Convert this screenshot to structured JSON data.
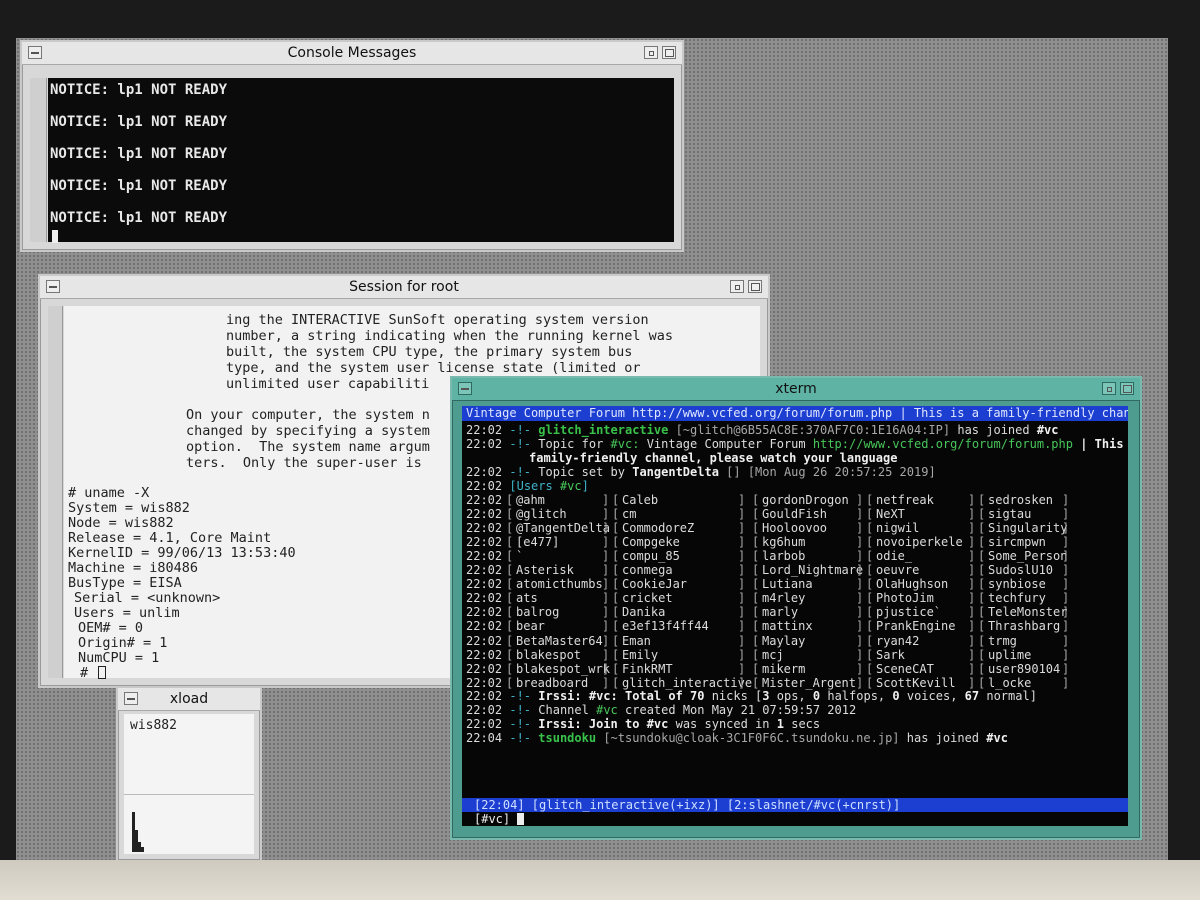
{
  "console": {
    "title": "Console Messages",
    "lines": [
      "NOTICE: lp1 NOT READY",
      "NOTICE: lp1 NOT READY",
      "NOTICE: lp1 NOT READY",
      "NOTICE: lp1 NOT READY",
      "NOTICE: lp1 NOT READY"
    ]
  },
  "session": {
    "title": "Session for root",
    "man_lines": [
      "ing the INTERACTIVE SunSoft operating system version",
      "number, a string indicating when the running kernel was",
      "built, the system CPU type, the primary system bus",
      "type, and the system user license state (limited or",
      "unlimited user capabiliti"
    ],
    "man_lines2": [
      "On your computer, the system n",
      "changed by specifying a system",
      "option.  The system name argum",
      "ters.  Only the super-user is"
    ],
    "cmd_lines": [
      "# uname -X",
      "System = wis882",
      "Node = wis882",
      "Release = 4.1, Core Maint",
      "KernelID = 99/06/13 13:53:40",
      "Machine = i80486",
      "BusType = EISA",
      "Serial = <unknown>",
      "Users = unlim",
      "OEM# = 0",
      "Origin# = 1",
      "NumCPU = 1",
      "# "
    ]
  },
  "xterm": {
    "title": "xterm",
    "topic_bar": "Vintage Computer Forum http://www.vcfed.org/forum/forum.php | This is a family-friendly channel, pl",
    "time": "22:02",
    "time_last": "22:04",
    "sep": "-!-",
    "join1": {
      "nick": "glitch_interactive",
      "host": "[~glitch@6B55AC8E:370AF7C0:1E16A04:IP]",
      "text": "has joined",
      "chan": "#vc"
    },
    "topic_line": {
      "prefix": "Topic for",
      "chan": "#vc:",
      "text": "Vintage Computer Forum",
      "url": "http://www.vcfed.org/forum/forum.php",
      "tail": "| This is a",
      "cont": "family-friendly channel, please watch your language"
    },
    "topic_set": {
      "prefix": "Topic set by",
      "nick": "TangentDelta",
      "rest": "[] [Mon Aug 26 20:57:25 2019]"
    },
    "users_header": {
      "label": "Users",
      "chan": "#vc"
    },
    "users": [
      [
        "@ahm",
        "Caleb",
        "gordonDrogon",
        "netfreak",
        "sedrosken"
      ],
      [
        "@glitch",
        "cm",
        "GouldFish",
        "NeXT",
        "sigtau"
      ],
      [
        "@TangentDelta",
        "CommodoreZ",
        "Hooloovoo",
        "nigwil",
        "Singularity"
      ],
      [
        "[e477]",
        "Compgeke",
        "kg6hum",
        "novoiperkele",
        "sircmpwn"
      ],
      [
        "`",
        "compu_85",
        "larbob",
        "odie_",
        "Some_Person"
      ],
      [
        "Asterisk",
        "conmega",
        "Lord_Nightmare",
        "oeuvre",
        "SudoslU10"
      ],
      [
        "atomicthumbs",
        "CookieJar",
        "Lutiana",
        "OlaHughson",
        "synbiose"
      ],
      [
        "ats",
        "cricket",
        "m4rley",
        "PhotoJim",
        "techfury"
      ],
      [
        "balrog",
        "Danika",
        "marly",
        "pjustice`",
        "TeleMonster"
      ],
      [
        "bear",
        "e3ef13f4ff44",
        "mattinx",
        "PrankEngine",
        "Thrashbarg"
      ],
      [
        "BetaMaster64",
        "Eman",
        "Maylay",
        "ryan42",
        "trmg"
      ],
      [
        "blakespot",
        "Emily",
        "mcj",
        "Sark",
        "uplime"
      ],
      [
        "blakespot_wrk",
        "FinkRMT",
        "mikerm",
        "SceneCAT",
        "user890104"
      ],
      [
        "breadboard",
        "glitch_interactive",
        "Mister_Argent",
        "ScottKevill",
        "l_ocke"
      ]
    ],
    "total": {
      "prefix": "Irssi: #vc: Total of",
      "count": "70",
      "nicks": "nicks [",
      "ops": "3",
      "ops_l": "ops,",
      "halfops": "0",
      "halfops_l": "halfops,",
      "voices": "0",
      "voices_l": "voices,",
      "normal": "67",
      "normal_l": "normal]"
    },
    "created": {
      "prefix": "Channel",
      "chan": "#vc",
      "text": "created Mon May 21 07:59:57 2012"
    },
    "synced": {
      "prefix": "Irssi: Join to",
      "chan": "#vc",
      "mid": "was synced in",
      "secs": "1",
      "tail": "secs"
    },
    "join2": {
      "nick": "tsundoku",
      "host": "[~tsundoku@cloak-3C1F0F6C.tsundoku.ne.jp]",
      "text": "has joined",
      "chan": "#vc"
    },
    "status": "[22:04] [glitch_interactive(+ixz)] [2:slashnet/#vc(+cnrst)]",
    "prompt": "[#vc] "
  },
  "xload": {
    "title": "xload",
    "host": "wis882"
  },
  "colors": {
    "nick": "#39c24a",
    "topic_bg": "#1c3fd2",
    "xterm_frame": "#4e9b8f"
  }
}
